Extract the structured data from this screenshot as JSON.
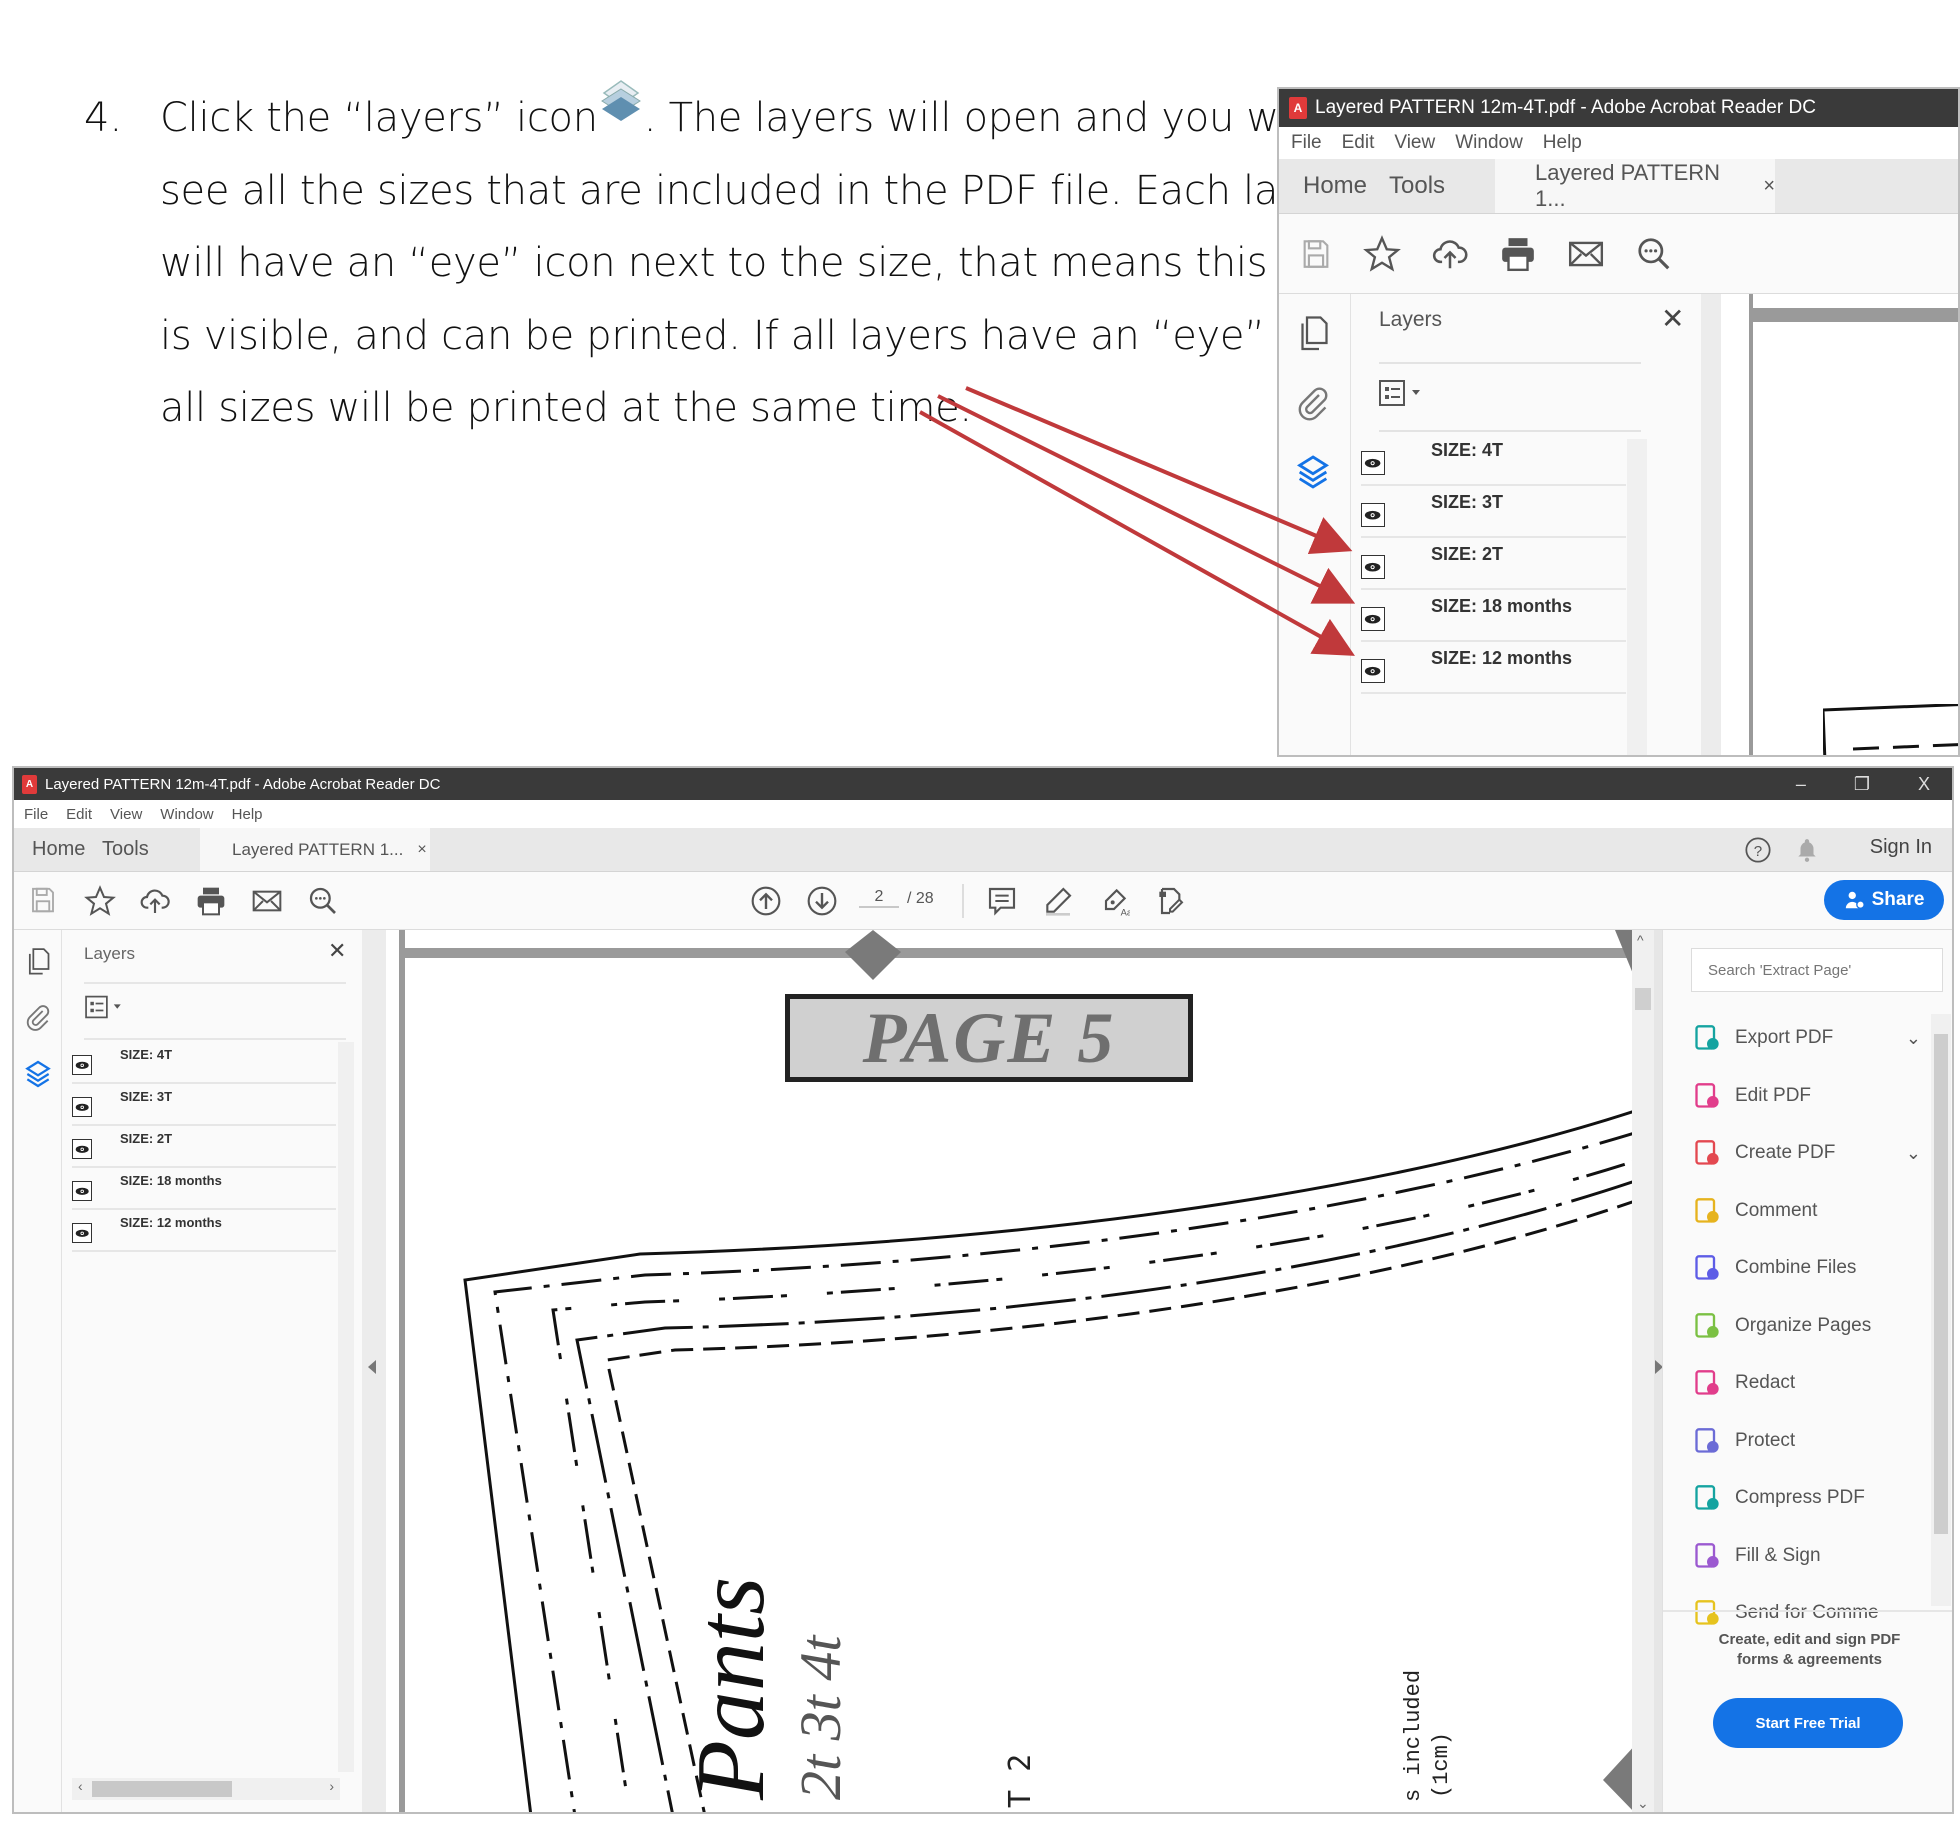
{
  "instructions": {
    "step_number": "4.",
    "lines": [
      "Click the “layers” icon",
      ". The layers will open and you will",
      "see all the sizes that are included in the PDF file. Each layer",
      "will have an “eye” icon next to the size, that means this size",
      "is visible, and can be printed.  If all layers have an “eye” then",
      "all sizes will be printed at the same time."
    ],
    "arrow_color": "#c0393b"
  },
  "app": {
    "window_title": "Layered PATTERN 12m-4T.pdf - Adobe Acrobat Reader DC",
    "menu": [
      "File",
      "Edit",
      "View",
      "Window",
      "Help"
    ],
    "tabs": {
      "home": "Home",
      "tools": "Tools",
      "document": "Layered PATTERN 1...",
      "close": "×"
    },
    "sign_in": "Sign In",
    "share": "Share",
    "page_current": "2",
    "page_total": "/ 28",
    "window_controls": {
      "minimize": "–",
      "restore": "❐",
      "close": "X"
    },
    "accent_color": "#1473e6"
  },
  "layers_panel": {
    "title": "Layers",
    "close": "✕",
    "layers": [
      {
        "label": "SIZE: 4T",
        "visible": true
      },
      {
        "label": "SIZE: 3T",
        "visible": true
      },
      {
        "label": "SIZE: 2T",
        "visible": true
      },
      {
        "label": "SIZE: 18 months",
        "visible": true
      },
      {
        "label": "SIZE: 12 months",
        "visible": true
      }
    ]
  },
  "document": {
    "page_label": "PAGE 5",
    "pattern_title": "Pants",
    "pattern_sizes": "2t  3t  4t",
    "seam_note_1": "s included",
    "seam_note_2": "(1cm)",
    "fragment": "T  2"
  },
  "tools_panel": {
    "search_placeholder": "Search 'Extract Page'",
    "items": [
      {
        "label": "Export PDF",
        "icon": "export-pdf-icon",
        "color": "#14a3a0",
        "expand": true
      },
      {
        "label": "Edit PDF",
        "icon": "edit-pdf-icon",
        "color": "#e13d8b",
        "expand": false
      },
      {
        "label": "Create PDF",
        "icon": "create-pdf-icon",
        "color": "#e34850",
        "expand": true
      },
      {
        "label": "Comment",
        "icon": "comment-icon",
        "color": "#e6b31e",
        "expand": false
      },
      {
        "label": "Combine Files",
        "icon": "combine-files-icon",
        "color": "#5d5ce6",
        "expand": false
      },
      {
        "label": "Organize Pages",
        "icon": "organize-pages-icon",
        "color": "#7bc043",
        "expand": false
      },
      {
        "label": "Redact",
        "icon": "redact-icon",
        "color": "#e13d8b",
        "expand": false
      },
      {
        "label": "Protect",
        "icon": "protect-icon",
        "color": "#6b6bd6",
        "expand": false
      },
      {
        "label": "Compress PDF",
        "icon": "compress-pdf-icon",
        "color": "#14a3a0",
        "expand": false
      },
      {
        "label": "Fill & Sign",
        "icon": "fill-sign-icon",
        "color": "#9b59d0",
        "expand": false
      },
      {
        "label": "Send for Comme",
        "icon": "send-for-comment-icon",
        "color": "#e6c31e",
        "expand": false
      }
    ],
    "promo_line1": "Create, edit and sign PDF",
    "promo_line2": "forms & agreements",
    "trial_button": "Start Free Trial",
    "expand_glyph": "⌄"
  }
}
